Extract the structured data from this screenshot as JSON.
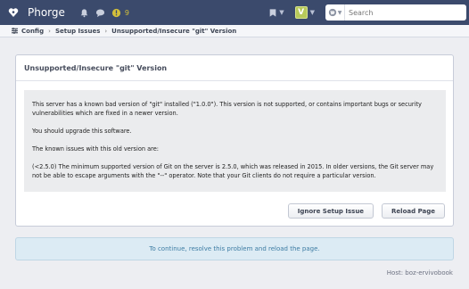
{
  "app": {
    "name": "Phorge",
    "notification_count": "9"
  },
  "search": {
    "placeholder": "Search"
  },
  "user": {
    "avatar_letter": "V"
  },
  "breadcrumb": {
    "items": [
      "Config",
      "Setup Issues",
      "Unsupported/Insecure \"git\" Version"
    ]
  },
  "issue": {
    "title": "Unsupported/Insecure \"git\" Version",
    "paragraphs": [
      "This server has a known bad version of \"git\" installed (\"1.0.0\"). This version is not supported, or contains important bugs or security vulnerabilities which are fixed in a newer version.",
      "You should upgrade this software.",
      "The known issues with this old version are:",
      "(<2.5.0) The minimum supported version of Git on the server is 2.5.0, which was released in 2015. In older versions, the Git server may not be able to escape arguments with the \"--\" operator. Note that your Git clients do not require a particular version."
    ],
    "ignore_label": "Ignore Setup Issue",
    "reload_label": "Reload Page"
  },
  "notice": "To continue, resolve this problem and reload the page.",
  "host": "Host: boz-ervivobook",
  "colors": {
    "topbar": "#3b4a6c",
    "notice_bg": "#dcebf4",
    "notice_text": "#3d7ca3",
    "notification_yellow": "#d4c03a"
  },
  "icons": [
    "phorge-logo-icon",
    "bell-icon",
    "chat-icon",
    "flag-icon",
    "globe-icon",
    "search-icon",
    "gear-icon"
  ]
}
